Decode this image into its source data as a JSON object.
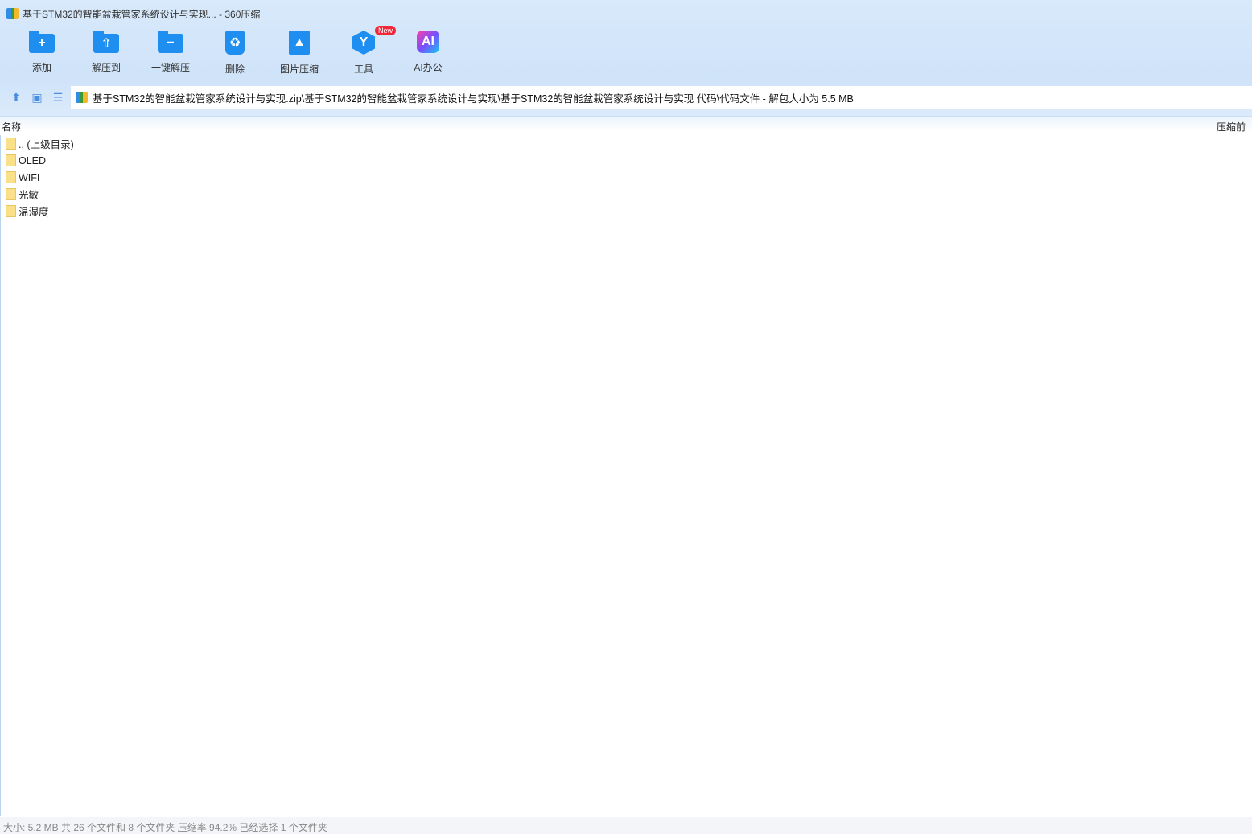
{
  "window": {
    "title": "基于STM32的智能盆栽管家系统设计与实现... - 360压缩"
  },
  "toolbar": [
    {
      "label": "添加",
      "icon": "add-folder-icon",
      "glyph": "+"
    },
    {
      "label": "解压到",
      "icon": "extract-to-icon",
      "glyph": "⇧"
    },
    {
      "label": "一键解压",
      "icon": "one-click-extract-icon",
      "glyph": "−"
    },
    {
      "label": "删除",
      "icon": "recycle-bin-icon",
      "glyph": "♻"
    },
    {
      "label": "图片压缩",
      "icon": "image-compress-icon",
      "glyph": "▲"
    },
    {
      "label": "工具",
      "icon": "tools-icon",
      "glyph": "Y",
      "badge": "New"
    },
    {
      "label": "AI办公",
      "icon": "ai-office-icon",
      "glyph": "AI"
    }
  ],
  "address": {
    "path": "基于STM32的智能盆栽管家系统设计与实现.zip\\基于STM32的智能盆栽管家系统设计与实现\\基于STM32的智能盆栽管家系统设计与实现 代码\\代码文件 - 解包大小为 5.5 MB"
  },
  "columns": {
    "name": "名称",
    "before": "压缩前"
  },
  "files": [
    ".. (上级目录)",
    "OLED",
    "WIFI",
    "光敏",
    "温湿度"
  ],
  "status": "大小: 5.2 MB 共 26 个文件和 8 个文件夹 压缩率 94.2% 已经选择 1 个文件夹"
}
